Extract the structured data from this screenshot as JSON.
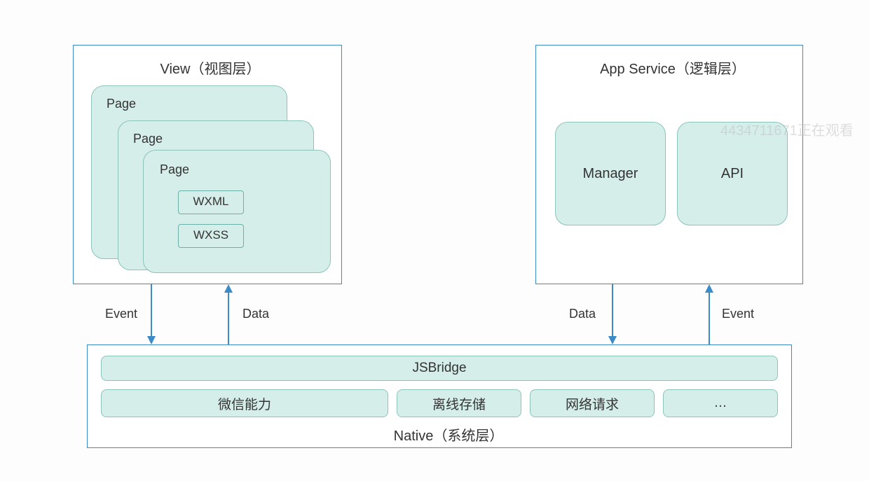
{
  "view": {
    "title": "View（视图层）",
    "page_label": "Page",
    "wxml": "WXML",
    "wxss": "WXSS"
  },
  "appservice": {
    "title": "App Service（逻辑层）",
    "manager": "Manager",
    "api": "API"
  },
  "arrows": {
    "view_event": "Event",
    "view_data": "Data",
    "svc_data": "Data",
    "svc_event": "Event"
  },
  "native": {
    "title": "Native（系统层）",
    "jsbridge": "JSBridge",
    "wechat": "微信能力",
    "offline": "离线存储",
    "network": "网络请求",
    "more": "…"
  },
  "watermark": "4434711671正在观看"
}
